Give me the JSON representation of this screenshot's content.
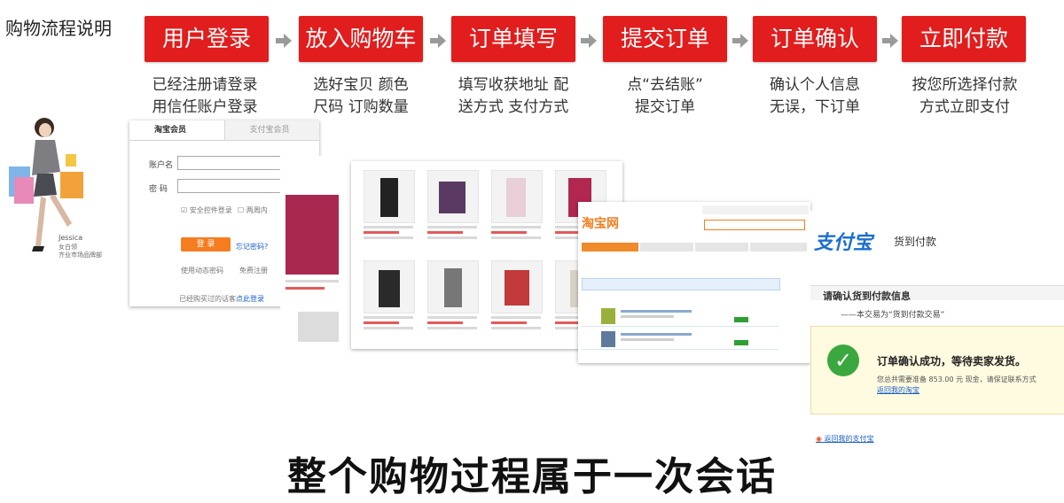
{
  "page_title": "购物流程说明",
  "steps": [
    {
      "label": "用户登录",
      "desc": [
        "已经注册请登录",
        "用信任账户登录"
      ]
    },
    {
      "label": "放入购物车",
      "desc": [
        "选好宝贝  颜色",
        "尺码  订购数量"
      ]
    },
    {
      "label": "订单填写",
      "desc": [
        "填写收获地址 配",
        "送方式 支付方式"
      ]
    },
    {
      "label": "提交订单",
      "desc": [
        "点“去结账”",
        "提交订单"
      ]
    },
    {
      "label": "订单确认",
      "desc": [
        "确认个人信息",
        "无误，下订单"
      ]
    },
    {
      "label": "立即付款",
      "desc": [
        "按您所选择付款",
        "方式立即支付"
      ]
    }
  ],
  "model": {
    "name": "Jessica",
    "line1": "女白领",
    "line2": "齐业市场品牌部"
  },
  "login": {
    "tab_active": "淘宝会员",
    "tab_inactive": "支付宝会员",
    "account_label": "账户名",
    "password_label": "密  码",
    "safe_control": "安全控件登录",
    "two_week": "两周内",
    "login_button": "登 录",
    "forgot": "忘记密码?",
    "dynamic_pwd": "使用动态密码",
    "free_register": "免费注册",
    "bought_prompt": "已经购买过的话客",
    "click_login": "点此登录"
  },
  "checkout": {
    "taobao_logo": "淘宝网"
  },
  "alipay": {
    "logo": "支付宝",
    "logo_suffix": "货到付款",
    "section_title": "请确认货到付款信息",
    "trade_type": "——本交易为“货到付款交易”",
    "success": "订单确认成功，等待卖家发货。",
    "amount_note": "您总共需要准备 853.00 元 现金，请保证联系方式",
    "back_taobao": "返回我的淘宝",
    "back_alipay": "返回我的支付宝"
  },
  "caption": "整个购物过程属于一次会话",
  "colors": {
    "step_red": "#e11d1d",
    "arrow_grey": "#9a9a9a",
    "taobao_orange": "#f57c1f",
    "alipay_blue": "#1a6fd0"
  }
}
